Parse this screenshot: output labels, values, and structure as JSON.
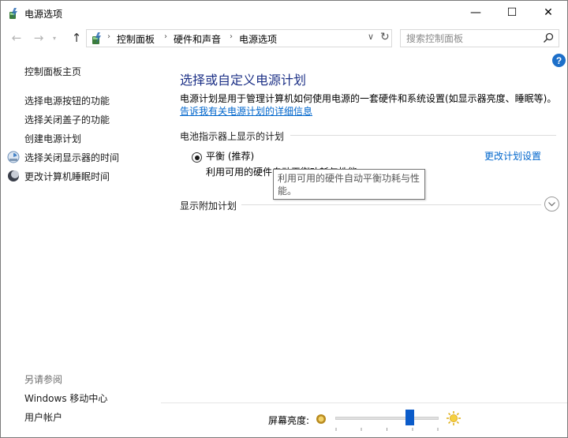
{
  "window": {
    "title": "电源选项",
    "controls": {
      "minimize": "—",
      "maximize": "☐",
      "close": "✕"
    }
  },
  "addressbar": {
    "breadcrumbs": [
      "控制面板",
      "硬件和声音",
      "电源选项"
    ],
    "search_placeholder": "搜索控制面板"
  },
  "sidebar": {
    "home": "控制面板主页",
    "links": [
      "选择电源按钮的功能",
      "选择关闭盖子的功能",
      "创建电源计划",
      "选择关闭显示器的时间",
      "更改计算机睡眠时间"
    ],
    "see_also_heading": "另请参阅",
    "see_also": [
      "Windows 移动中心",
      "用户帐户"
    ]
  },
  "main": {
    "title": "选择或自定义电源计划",
    "description": "电源计划是用于管理计算机如何使用电源的一套硬件和系统设置(如显示器亮度、睡眠等)。",
    "learn_more": "告诉我有关电源计划的详细信息",
    "battery_section": "电池指示器上显示的计划",
    "plan": {
      "name": "平衡 (推荐)",
      "description": "利用可用的硬件自动平衡功耗与性能",
      "change_link": "更改计划设置",
      "selected": true
    },
    "tooltip": "利用可用的硬件自动平衡功耗与性能。",
    "additional_plans": "显示附加计划"
  },
  "brightness": {
    "label": "屏幕亮度:",
    "level_percent": 72
  },
  "colors": {
    "title_blue": "#1e3287",
    "link_blue": "#0066cc",
    "slider_thumb": "#0b5bc9",
    "help_blue": "#1d6fc9"
  }
}
